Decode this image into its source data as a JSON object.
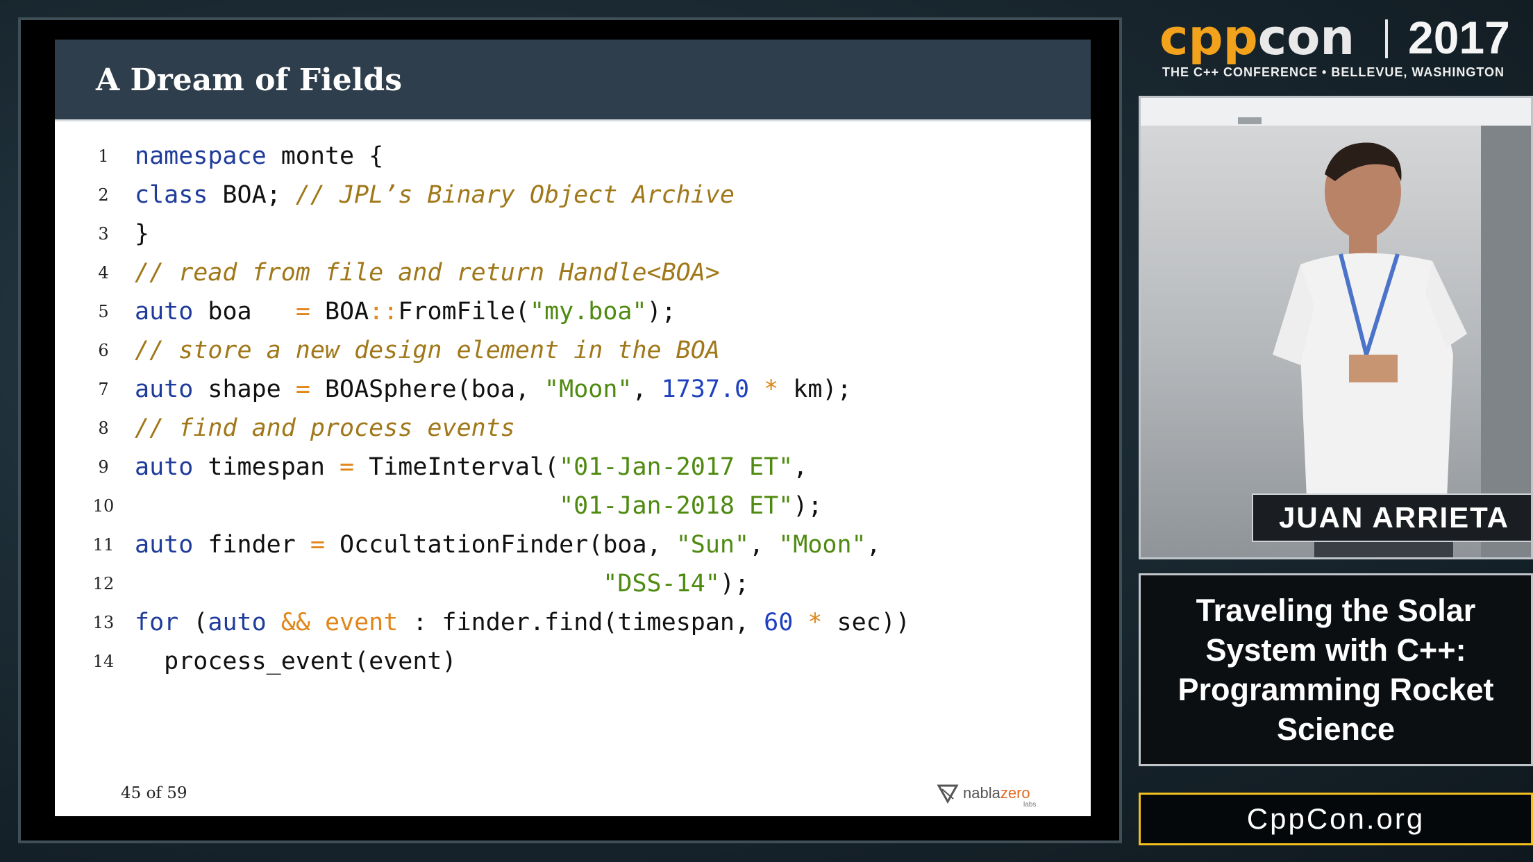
{
  "slide": {
    "title": "A Dream of Fields",
    "page_counter": "45 of 59",
    "logo": {
      "name": "nabla",
      "accent": "zero",
      "sub": "labs"
    },
    "code_lines": [
      {
        "num": "1",
        "tokens": [
          {
            "t": "namespace",
            "c": "kw"
          },
          {
            "t": " monte {",
            "c": "plain"
          }
        ]
      },
      {
        "num": "2",
        "tokens": [
          {
            "t": "class",
            "c": "kw"
          },
          {
            "t": " BOA; ",
            "c": "plain"
          },
          {
            "t": "// JPL’s Binary Object Archive",
            "c": "cm"
          }
        ]
      },
      {
        "num": "3",
        "tokens": [
          {
            "t": "}",
            "c": "plain"
          }
        ]
      },
      {
        "num": "4",
        "tokens": [
          {
            "t": "// read from file and return Handle<BOA>",
            "c": "cm"
          }
        ]
      },
      {
        "num": "5",
        "tokens": [
          {
            "t": "auto",
            "c": "kw"
          },
          {
            "t": " boa   ",
            "c": "plain"
          },
          {
            "t": "=",
            "c": "op"
          },
          {
            "t": " BOA",
            "c": "plain"
          },
          {
            "t": "::",
            "c": "op"
          },
          {
            "t": "FromFile(",
            "c": "plain"
          },
          {
            "t": "\"my.boa\"",
            "c": "str"
          },
          {
            "t": ");",
            "c": "plain"
          }
        ]
      },
      {
        "num": "6",
        "tokens": [
          {
            "t": "// store a new design element in the BOA",
            "c": "cm"
          }
        ]
      },
      {
        "num": "7",
        "tokens": [
          {
            "t": "auto",
            "c": "kw"
          },
          {
            "t": " shape ",
            "c": "plain"
          },
          {
            "t": "=",
            "c": "op"
          },
          {
            "t": " BOASphere(boa, ",
            "c": "plain"
          },
          {
            "t": "\"Moon\"",
            "c": "str"
          },
          {
            "t": ", ",
            "c": "plain"
          },
          {
            "t": "1737.0",
            "c": "num"
          },
          {
            "t": " ",
            "c": "plain"
          },
          {
            "t": "*",
            "c": "op"
          },
          {
            "t": " km);",
            "c": "plain"
          }
        ]
      },
      {
        "num": "8",
        "tokens": [
          {
            "t": "// find and process events",
            "c": "cm"
          }
        ]
      },
      {
        "num": "9",
        "tokens": [
          {
            "t": "auto",
            "c": "kw"
          },
          {
            "t": " timespan ",
            "c": "plain"
          },
          {
            "t": "=",
            "c": "op"
          },
          {
            "t": " TimeInterval(",
            "c": "plain"
          },
          {
            "t": "\"01-Jan-2017 ET\"",
            "c": "str"
          },
          {
            "t": ",",
            "c": "plain"
          }
        ]
      },
      {
        "num": "10",
        "tokens": [
          {
            "t": "                             ",
            "c": "plain"
          },
          {
            "t": "\"01-Jan-2018 ET\"",
            "c": "str"
          },
          {
            "t": ");",
            "c": "plain"
          }
        ]
      },
      {
        "num": "11",
        "tokens": [
          {
            "t": "auto",
            "c": "kw"
          },
          {
            "t": " finder ",
            "c": "plain"
          },
          {
            "t": "=",
            "c": "op"
          },
          {
            "t": " OccultationFinder(boa, ",
            "c": "plain"
          },
          {
            "t": "\"Sun\"",
            "c": "str"
          },
          {
            "t": ", ",
            "c": "plain"
          },
          {
            "t": "\"Moon\"",
            "c": "str"
          },
          {
            "t": ",",
            "c": "plain"
          }
        ]
      },
      {
        "num": "12",
        "tokens": [
          {
            "t": "                                ",
            "c": "plain"
          },
          {
            "t": "\"DSS-14\"",
            "c": "str"
          },
          {
            "t": ");",
            "c": "plain"
          }
        ]
      },
      {
        "num": "13",
        "tokens": [
          {
            "t": "for",
            "c": "kw"
          },
          {
            "t": " (",
            "c": "plain"
          },
          {
            "t": "auto",
            "c": "kw"
          },
          {
            "t": " ",
            "c": "plain"
          },
          {
            "t": "&& event",
            "c": "op"
          },
          {
            "t": " : finder.find(timespan, ",
            "c": "plain"
          },
          {
            "t": "60",
            "c": "num"
          },
          {
            "t": " ",
            "c": "plain"
          },
          {
            "t": "*",
            "c": "op"
          },
          {
            "t": " sec))",
            "c": "plain"
          }
        ]
      },
      {
        "num": "14",
        "tokens": [
          {
            "t": "  process_event(event)",
            "c": "plain"
          }
        ]
      }
    ]
  },
  "conference": {
    "name_accent": "cpp",
    "name_rest": "con",
    "year": "2017",
    "tagline": "THE C++ CONFERENCE • BELLEVUE, WASHINGTON"
  },
  "speaker": {
    "name": "JUAN ARRIETA"
  },
  "talk": {
    "title": "Traveling the Solar System with C++: Programming Rocket Science"
  },
  "website": {
    "url": "CppCon.org"
  },
  "colors": {
    "brand_orange": "#f3a21c",
    "keyword_blue": "#1f3c9a",
    "comment_gold": "#a0781a",
    "string_green": "#4f8a10",
    "url_border_yellow": "#f1bf1e"
  }
}
